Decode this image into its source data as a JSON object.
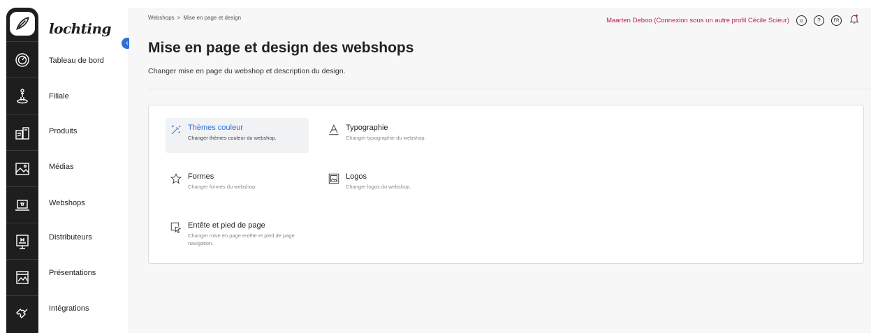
{
  "brand": "lochting",
  "breadcrumb": {
    "parent": "Webshops",
    "separator": ">",
    "current": "Mise en page et design"
  },
  "topbar": {
    "user_text": "Maarten Deboo (Connexion sous un autre profil Cécile Scieur)",
    "lang": "FR",
    "help": "?"
  },
  "sidebar": {
    "items": [
      {
        "label": "Tableau de bord",
        "icon": "gauge-icon"
      },
      {
        "label": "Filiale",
        "icon": "map-pin-icon"
      },
      {
        "label": "Produits",
        "icon": "products-icon"
      },
      {
        "label": "Médias",
        "icon": "image-icon"
      },
      {
        "label": "Webshops",
        "icon": "laptop-cart-icon"
      },
      {
        "label": "Distributeurs",
        "icon": "dispenser-icon"
      },
      {
        "label": "Présentations",
        "icon": "presentation-icon"
      },
      {
        "label": "Intégrations",
        "icon": "puzzle-icon"
      }
    ]
  },
  "page": {
    "title": "Mise en page et design des webshops",
    "description": "Changer mise en page du webshop et description du design."
  },
  "options": [
    {
      "title": "Thèmes couleur",
      "desc": "Changer thèmes couleur du webshop.",
      "icon": "magic-wand-icon"
    },
    {
      "title": "Typographie",
      "desc": "Changer typographie du webshop.",
      "icon": "typography-icon"
    },
    {
      "title": "Formes",
      "desc": "Changer formes du webshop.",
      "icon": "star-icon"
    },
    {
      "title": "Logos",
      "desc": "Changer logos du webshop.",
      "icon": "image-frame-icon"
    },
    {
      "title": "Entête et pied de page",
      "desc": "Changer mise en page entête et pied de page navigation.",
      "icon": "cursor-frame-icon"
    }
  ],
  "colors": {
    "accent": "#2f6fd6",
    "user_text": "#c0185b",
    "rail": "#1e1e1e"
  }
}
